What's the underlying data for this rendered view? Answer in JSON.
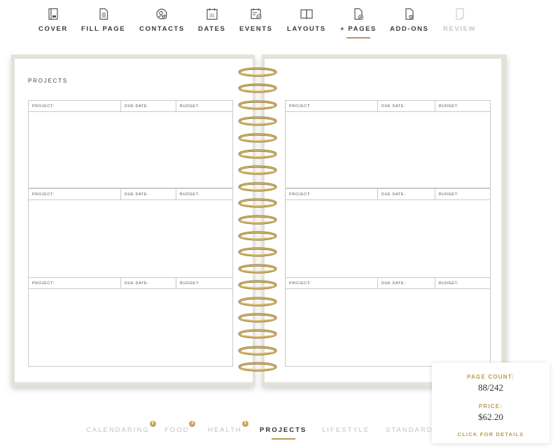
{
  "nav": {
    "items": [
      {
        "label": "COVER",
        "icon": "cover-icon",
        "state": "normal"
      },
      {
        "label": "FILL PAGE",
        "icon": "page-icon",
        "state": "normal"
      },
      {
        "label": "CONTACTS",
        "icon": "contacts-icon",
        "state": "normal"
      },
      {
        "label": "DATES",
        "icon": "calendar-icon",
        "calendar_day": "31",
        "state": "normal"
      },
      {
        "label": "EVENTS",
        "icon": "events-icon",
        "state": "normal"
      },
      {
        "label": "LAYOUTS",
        "icon": "layouts-icon",
        "state": "normal"
      },
      {
        "label": "+ PAGES",
        "icon": "add-page-icon",
        "state": "active"
      },
      {
        "label": "ADD-ONS",
        "icon": "add-ons-icon",
        "state": "normal"
      },
      {
        "label": "REVIEW",
        "icon": "review-icon",
        "state": "disabled"
      }
    ]
  },
  "planner": {
    "left_page_title": "PROJECTS",
    "project_headers": {
      "project": "PROJECT:",
      "due_date": "DUE DATE:",
      "budget": "BUDGET:"
    }
  },
  "price_card": {
    "page_count_label": "PAGE COUNT:",
    "page_count_value": "88/242",
    "price_label": "PRICE:",
    "price_value": "$62.20",
    "details_link": "CLICK FOR DETAILS"
  },
  "categories": [
    {
      "label": "CALENDARING",
      "badge": "2",
      "active": false
    },
    {
      "label": "FOOD",
      "badge": "2",
      "active": false
    },
    {
      "label": "HEALTH",
      "badge": "1",
      "active": false
    },
    {
      "label": "PROJECTS",
      "badge": "",
      "active": true
    },
    {
      "label": "LIFESTYLE",
      "badge": "",
      "active": false
    },
    {
      "label": "STANDARD",
      "badge": "",
      "active": false
    }
  ],
  "colors": {
    "accent_gold": "#b89a55",
    "cover_linen": "#e4e2d8",
    "text_dark": "#3a3a3a",
    "text_muted": "#c2c2c2"
  }
}
